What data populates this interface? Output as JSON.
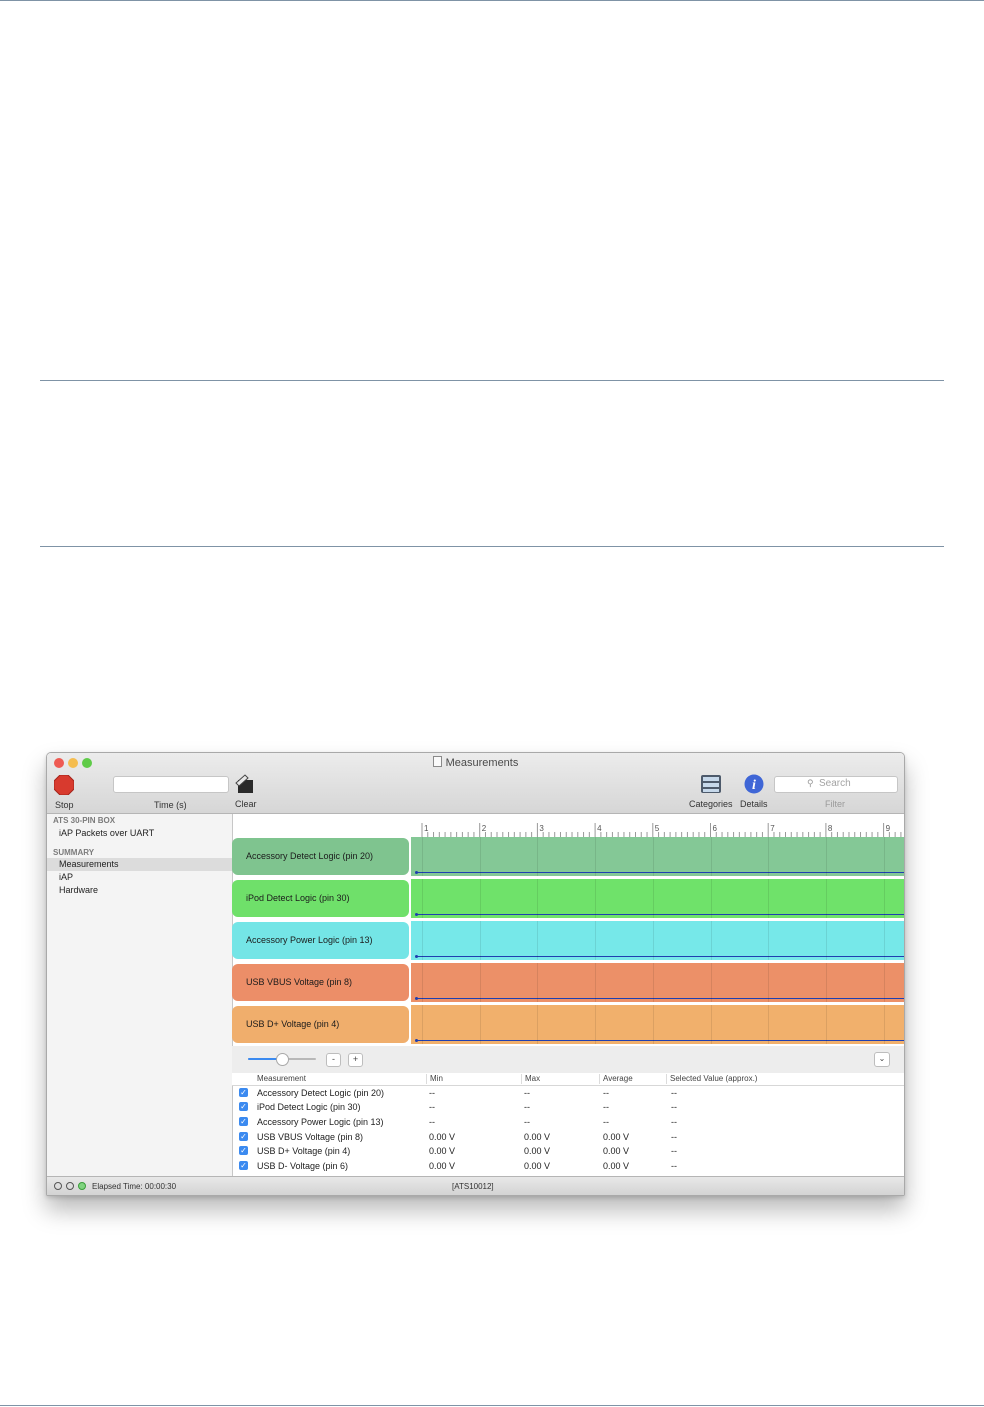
{
  "window": {
    "title": "Measurements",
    "traffic_light_colors": [
      "#ee5a52",
      "#f5bd4f",
      "#5fcb48"
    ]
  },
  "toolbar": {
    "stop_label": "Stop",
    "time_label": "Time (s)",
    "time_value": "",
    "clear_label": "Clear",
    "categories_label": "Categories",
    "details_label": "Details",
    "search_placeholder": "Search",
    "filter_label": "Filter"
  },
  "sidebar": {
    "section1": "ATS 30-PIN BOX",
    "section1_items": [
      "iAP Packets over UART"
    ],
    "section2": "SUMMARY",
    "section2_items": [
      "Measurements",
      "iAP",
      "Hardware"
    ],
    "selected": "Measurements"
  },
  "ruler": {
    "ticks": [
      "1",
      "2",
      "3",
      "4",
      "5",
      "6",
      "7",
      "8",
      "9"
    ]
  },
  "tracks": [
    {
      "label": "Accessory Detect Logic (pin 20)",
      "color": "#7fc48f"
    },
    {
      "label": "iPod Detect Logic (pin 30)",
      "color": "#6fe06a"
    },
    {
      "label": "Accessory Power Logic (pin 13)",
      "color": "#74e5e6"
    },
    {
      "label": "USB VBUS Voltage (pin 8)",
      "color": "#ec8e68"
    },
    {
      "label": "USB D+ Voltage (pin 4)",
      "color": "#f0ae6c"
    }
  ],
  "zoom": {
    "slider_level": 0.5,
    "minus_label": "-",
    "plus_label": "+"
  },
  "table": {
    "columns": [
      "Measurement",
      "Min",
      "Max",
      "Average",
      "Selected Value (approx.)"
    ],
    "rows": [
      {
        "checked": true,
        "name": "Accessory Detect Logic (pin 20)",
        "min": "--",
        "max": "--",
        "avg": "--",
        "sel": "--"
      },
      {
        "checked": true,
        "name": "iPod Detect Logic (pin 30)",
        "min": "--",
        "max": "--",
        "avg": "--",
        "sel": "--"
      },
      {
        "checked": true,
        "name": "Accessory Power Logic (pin 13)",
        "min": "--",
        "max": "--",
        "avg": "--",
        "sel": "--"
      },
      {
        "checked": true,
        "name": "USB VBUS Voltage (pin 8)",
        "min": "0.00 V",
        "max": "0.00 V",
        "avg": "0.00 V",
        "sel": "--"
      },
      {
        "checked": true,
        "name": "USB D+ Voltage (pin 4)",
        "min": "0.00 V",
        "max": "0.00 V",
        "avg": "0.00 V",
        "sel": "--"
      },
      {
        "checked": true,
        "name": "USB D- Voltage (pin 6)",
        "min": "0.00 V",
        "max": "0.00 V",
        "avg": "0.00 V",
        "sel": "--"
      }
    ]
  },
  "status": {
    "elapsed": "Elapsed Time: 00:00:30",
    "device": "[ATS10012]"
  }
}
